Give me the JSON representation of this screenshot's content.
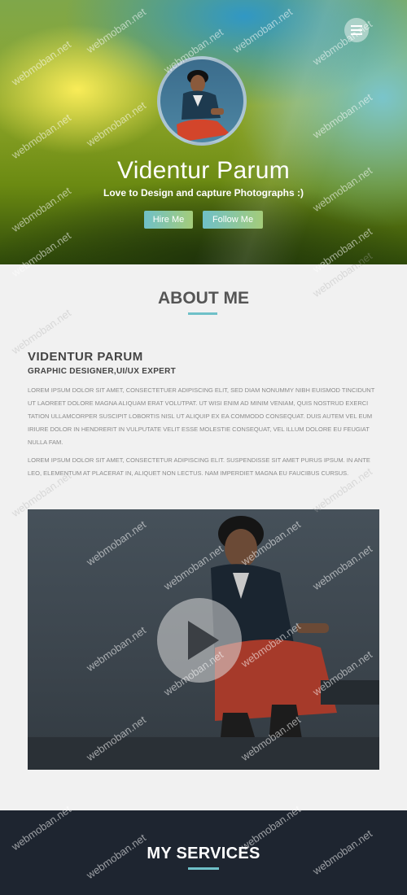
{
  "hero": {
    "name": "Videntur Parum",
    "tagline": "Love to Design and capture Photographs :)",
    "hire_label": "Hire Me",
    "follow_label": "Follow Me",
    "menu_icon": "hamburger-icon"
  },
  "about": {
    "title": "ABOUT ME",
    "name": "VIDENTUR PARUM",
    "role": "GRAPHIC DESIGNER,UI/UX EXPERT",
    "paragraph1": "LOREM IPSUM DOLOR SIT AMET, CONSECTETUER ADIPISCING ELIT, SED DIAM NONUMMY NIBH EUISMOD TINCIDUNT UT LAOREET DOLORE MAGNA ALIQUAM ERAT VOLUTPAT. UT WISI ENIM AD MINIM VENIAM, QUIS NOSTRUD EXERCI TATION ULLAMCORPER SUSCIPIT LOBORTIS NISL UT ALIQUIP EX EA COMMODO CONSEQUAT. DUIS AUTEM VEL EUM IRIURE DOLOR IN HENDRERIT IN VULPUTATE VELIT ESSE MOLESTIE CONSEQUAT, VEL ILLUM DOLORE EU FEUGIAT NULLA FAM.",
    "paragraph2": "LOREM IPSUM DOLOR SIT AMET, CONSECTETUR ADIPISCING ELIT. SUSPENDISSE SIT AMET PURUS IPSUM. IN ANTE LEO, ELEMENTUM AT PLACERAT IN, ALIQUET NON LECTUS. NAM IMPERDIET MAGNA EU FAUCIBUS CURSUS."
  },
  "video": {
    "play_icon": "play-icon"
  },
  "services": {
    "title": "MY SERVICES"
  },
  "watermark": "webmoban.net",
  "colors": {
    "accent": "#6fc0c8",
    "services_bg": "#1e2530",
    "page_bg": "#f1f1f1"
  }
}
